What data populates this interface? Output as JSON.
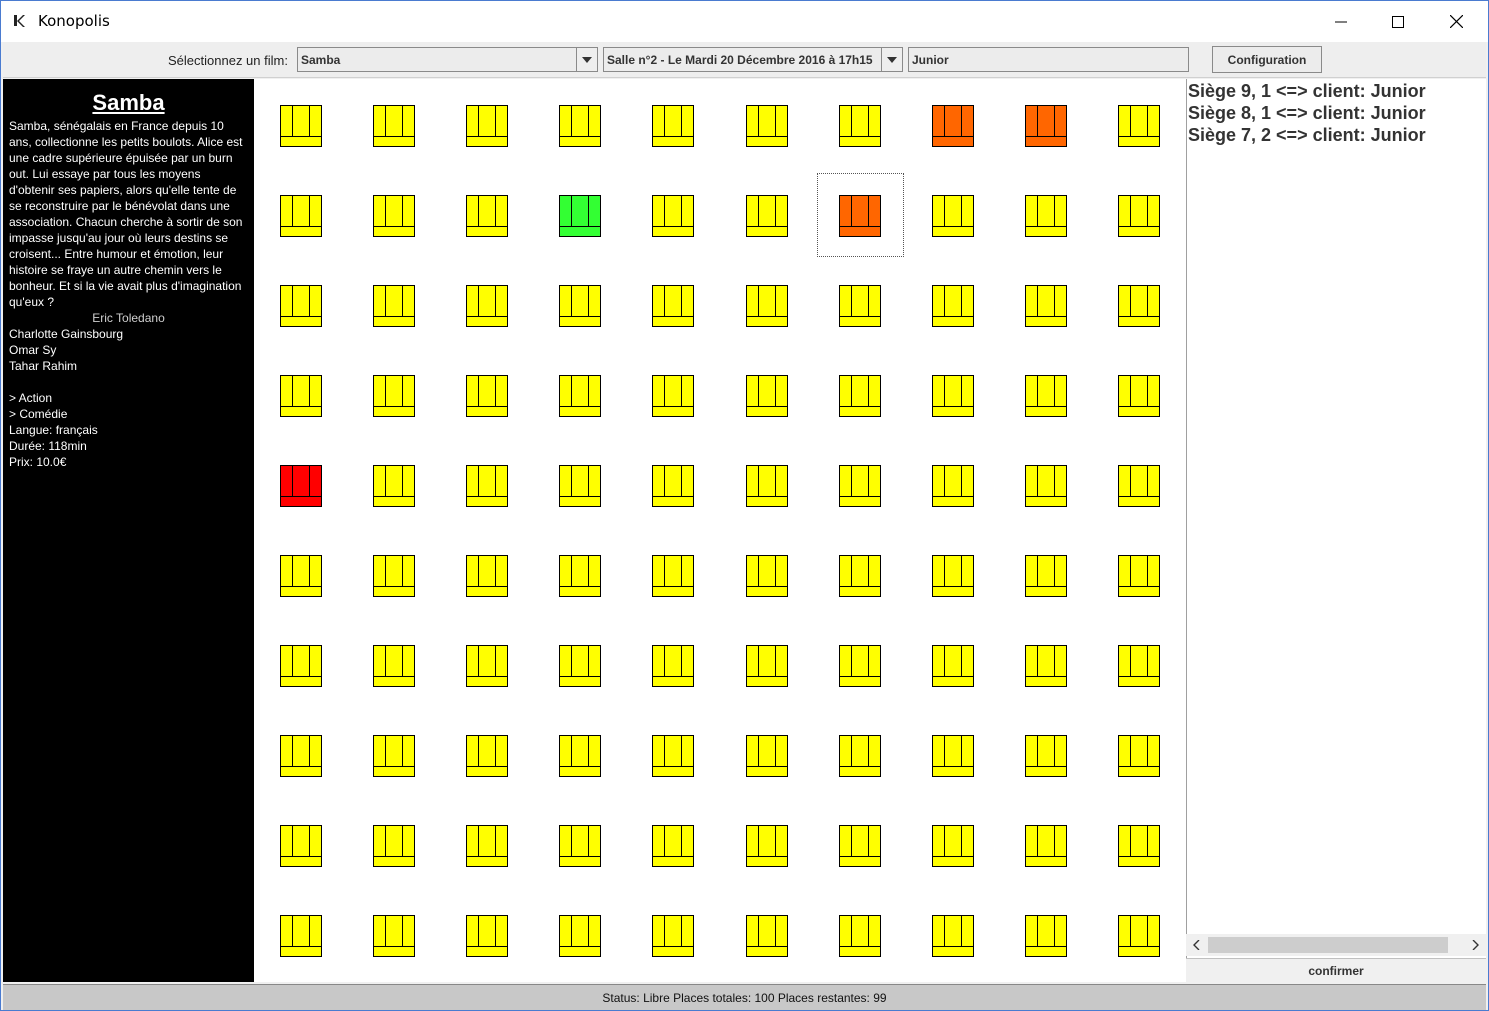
{
  "window": {
    "title": "Konopolis",
    "controls": [
      "minimize-icon",
      "maximize-icon",
      "close-icon"
    ]
  },
  "toolbar": {
    "film_label": "Sélectionnez un film:",
    "film_selected": "Samba",
    "session_selected": "Salle n°2 - Le Mardi 20 Décembre 2016 à 17h15",
    "client_value": "Junior",
    "config_label": "Configuration"
  },
  "film": {
    "title": "Samba",
    "synopsis": "Samba, sénégalais en France depuis 10 ans, collectionne les petits boulots. Alice est une cadre supérieure épuisée par un burn out. Lui essaye par tous les moyens d'obtenir ses papiers, alors qu'elle tente de se reconstruire par le bénévolat dans une association. Chacun cherche à sortir de son impasse jusqu'au jour où leurs destins se croisent... Entre humour et émotion, leur histoire se fraye un autre chemin vers le bonheur. Et si la vie avait plus d'imagination qu'eux ?",
    "director": "Eric Toledano",
    "actors": [
      "Charlotte Gainsbourg",
      "Omar Sy",
      "Tahar Rahim"
    ],
    "genres": [
      "> Action",
      "> Comédie"
    ],
    "language": "Langue: français",
    "duration": "Durée: 118min",
    "price": "Prix: 10.0€"
  },
  "seat_colors": {
    "free": "#ffff00",
    "selected": "#ff6600",
    "taken": "#ff0000",
    "special": "#33ff33"
  },
  "seats": {
    "rows": 10,
    "cols": 10,
    "special": [
      {
        "row": 1,
        "col": 8,
        "state": "selected"
      },
      {
        "row": 1,
        "col": 9,
        "state": "selected"
      },
      {
        "row": 2,
        "col": 4,
        "state": "special"
      },
      {
        "row": 2,
        "col": 7,
        "state": "selected"
      },
      {
        "row": 5,
        "col": 1,
        "state": "taken"
      }
    ],
    "focused": {
      "row": 2,
      "col": 7
    }
  },
  "reservations": [
    "Siège 9, 1 <=> client: Junior",
    "Siège 8, 1 <=> client: Junior",
    "Siège 7, 2 <=> client: Junior"
  ],
  "confirm_label": "confirmer",
  "status_text": "Status: Libre Places totales: 100 Places restantes: 99"
}
